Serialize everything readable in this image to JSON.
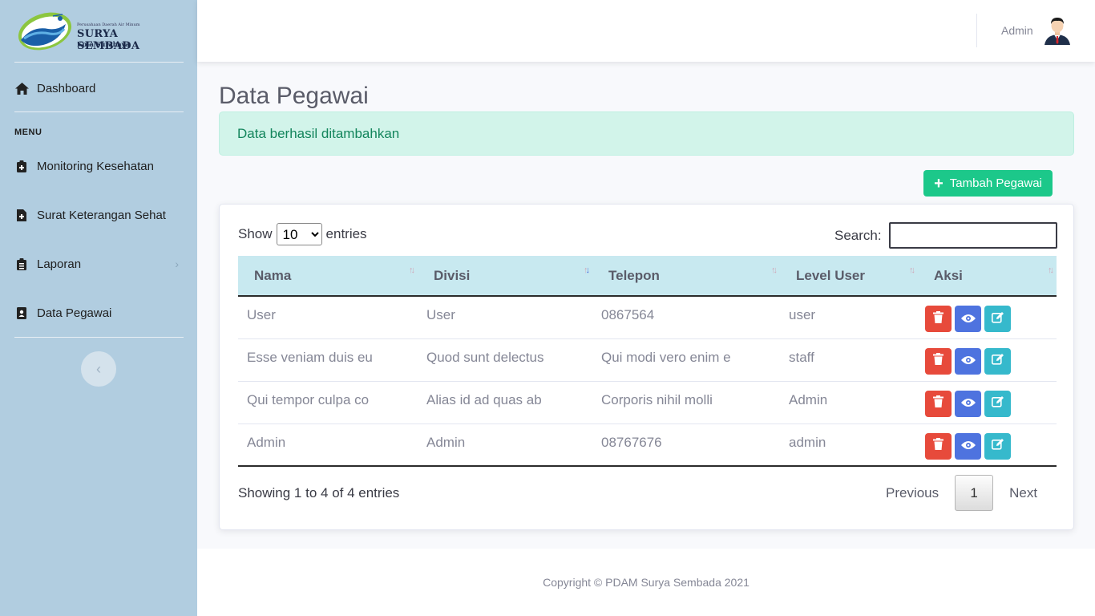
{
  "brand": {
    "tagline": "Perusahaan Daerah Air Minum",
    "name": "SURYA SEMBADA",
    "city": "Kota Surabaya"
  },
  "sidebar": {
    "dashboard": {
      "label": "Dashboard",
      "icon": "home-icon"
    },
    "heading": "MENU",
    "items": [
      {
        "label": "Monitoring Kesehatan",
        "icon": "clipboard-medical-icon"
      },
      {
        "label": "Surat Keterangan Sehat",
        "icon": "file-medical-icon"
      },
      {
        "label": "Laporan",
        "icon": "clipboard-list-icon",
        "has_submenu": true
      },
      {
        "label": "Data Pegawai",
        "icon": "id-badge-icon"
      }
    ]
  },
  "topbar": {
    "user_name": "Admin"
  },
  "page": {
    "title": "Data Pegawai",
    "alert": "Data berhasil ditambahkan",
    "add_button": "Tambah Pegawai"
  },
  "table_controls": {
    "show_label": "Show",
    "entries_value": "10",
    "entries_label": "entries",
    "search_label": "Search:",
    "search_value": ""
  },
  "table": {
    "columns": [
      "Nama",
      "Divisi",
      "Telepon",
      "Level User",
      "Aksi"
    ],
    "rows": [
      [
        "User",
        "User",
        "0867564",
        "user"
      ],
      [
        "Esse veniam duis eu",
        "Quod sunt delectus",
        "Qui modi vero enim e",
        "staff"
      ],
      [
        "Qui tempor culpa co",
        "Alias id ad quas ab",
        "Corporis nihil molli",
        "Admin"
      ],
      [
        "Admin",
        "Admin",
        "08767676",
        "admin"
      ]
    ]
  },
  "pagination": {
    "info": "Showing 1 to 4 of 4 entries",
    "previous": "Previous",
    "page": "1",
    "next": "Next"
  },
  "footer": {
    "copyright": "Copyright © PDAM Surya Sembada 2021"
  },
  "colors": {
    "sidebar": "#b1cde0",
    "success": "#1cc88a",
    "danger": "#e74a3b",
    "primary": "#4e73df",
    "info": "#36b9cc",
    "table_header": "#c8e9f0"
  }
}
